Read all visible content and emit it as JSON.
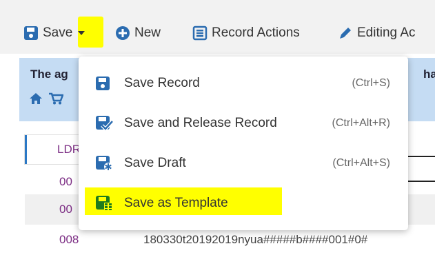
{
  "toolbar": {
    "save_label": "Save",
    "new_label": "New",
    "record_actions_label": "Record Actions",
    "editing_actions_label": "Editing Ac"
  },
  "banner": {
    "text_left": "The ag",
    "text_right": "han t"
  },
  "records": {
    "ldr_tag": "LDR",
    "row1_tag": "00",
    "row2_tag": "00",
    "row3_tag": "008",
    "row3_value": "180330t20192019nyua#####b####001#0#"
  },
  "menu": {
    "items": [
      {
        "label": "Save Record",
        "shortcut": "(Ctrl+S)",
        "icon": "save-icon"
      },
      {
        "label": "Save and Release Record",
        "shortcut": "(Ctrl+Alt+R)",
        "icon": "save-check-icon"
      },
      {
        "label": "Save Draft",
        "shortcut": "(Ctrl+Alt+S)",
        "icon": "save-asterisk-icon"
      },
      {
        "label": "Save as Template",
        "shortcut": "",
        "icon": "save-template-icon"
      }
    ]
  },
  "colors": {
    "accent_blue": "#2b6cb0",
    "template_green": "#1e7b1e",
    "highlight": "#ffff00",
    "banner": "#c5dcf3",
    "tag_purple": "#7b2c83"
  }
}
